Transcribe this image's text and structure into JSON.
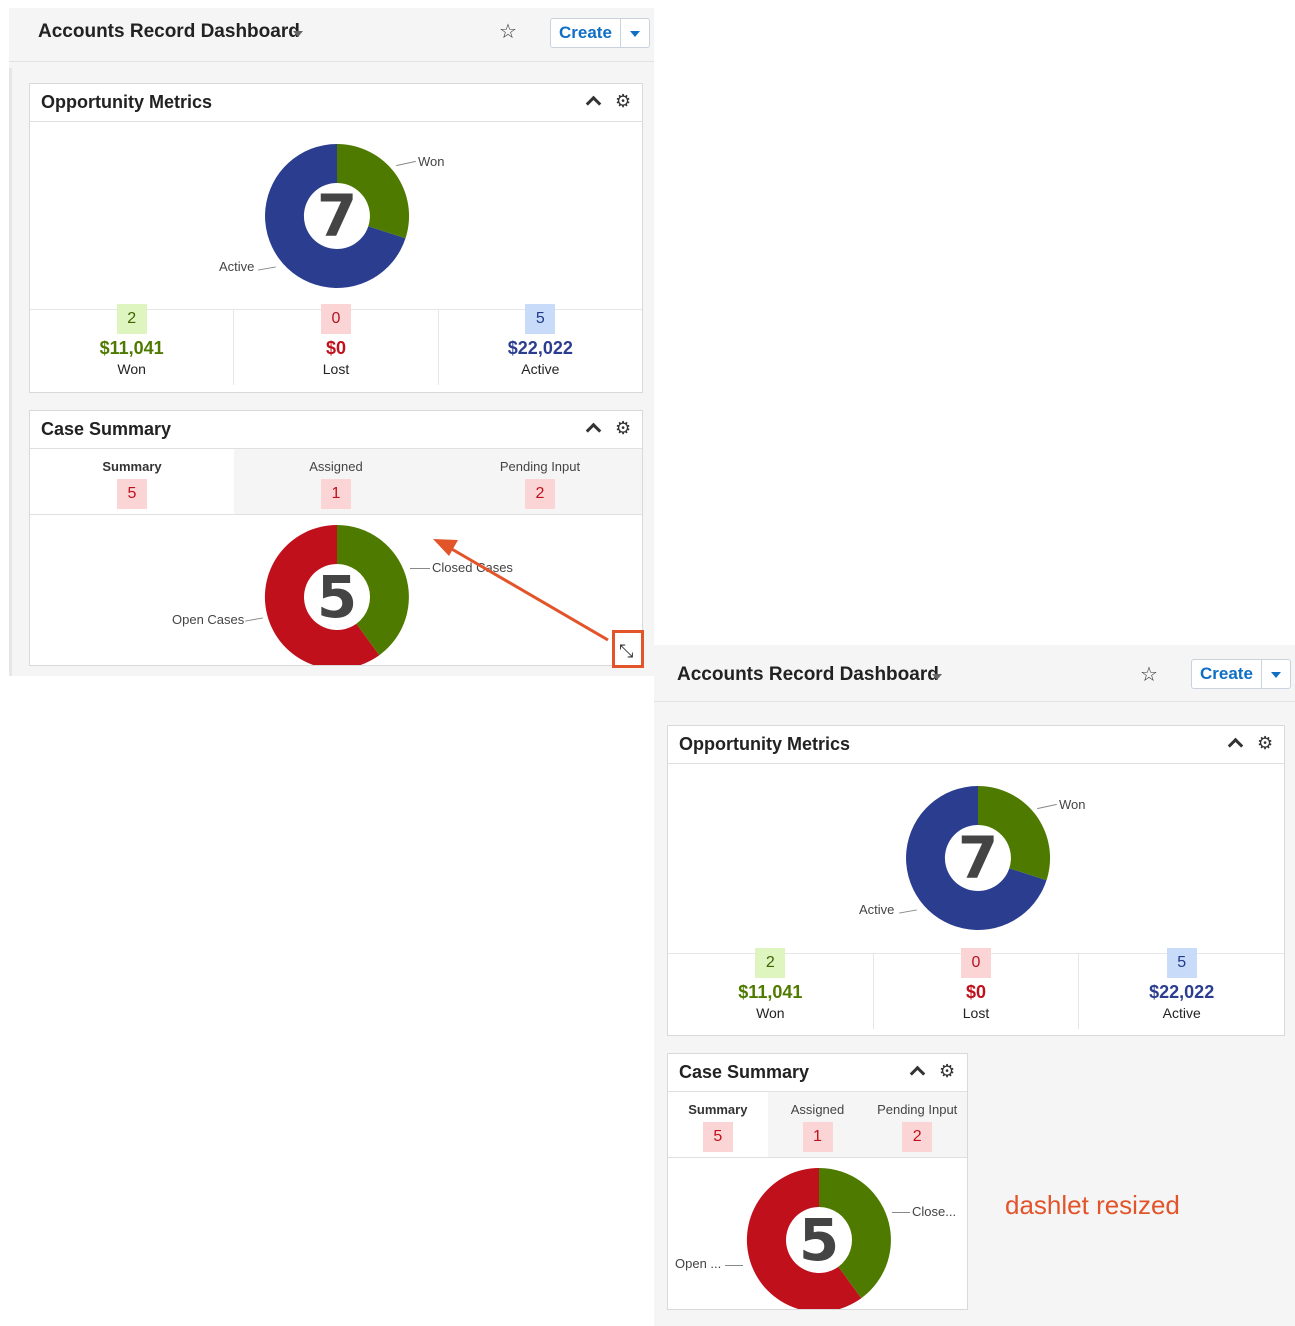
{
  "before": {
    "header": {
      "title": "Accounts Record Dashboard",
      "create_label": "Create"
    },
    "opportunity": {
      "title": "Opportunity Metrics",
      "total": "7",
      "labels": {
        "won": "Won",
        "active": "Active"
      },
      "metrics": [
        {
          "badge": "2",
          "amount": "$11,041",
          "label": "Won"
        },
        {
          "badge": "0",
          "amount": "$0",
          "label": "Lost"
        },
        {
          "badge": "5",
          "amount": "$22,022",
          "label": "Active"
        }
      ],
      "slices": {
        "won": 2,
        "lost": 0,
        "active": 5
      }
    },
    "cases": {
      "title": "Case Summary",
      "tabs": [
        {
          "label": "Summary",
          "count": "5"
        },
        {
          "label": "Assigned",
          "count": "1"
        },
        {
          "label": "Pending Input",
          "count": "2"
        }
      ],
      "total": "5",
      "labels": {
        "closed": "Closed Cases",
        "open": "Open Cases"
      },
      "slices": {
        "closed": 2,
        "open": 3
      }
    }
  },
  "after": {
    "header": {
      "title": "Accounts Record Dashboard",
      "create_label": "Create"
    },
    "opportunity": {
      "title": "Opportunity Metrics",
      "total": "7",
      "labels": {
        "won": "Won",
        "active": "Active"
      },
      "metrics": [
        {
          "badge": "2",
          "amount": "$11,041",
          "label": "Won"
        },
        {
          "badge": "0",
          "amount": "$0",
          "label": "Lost"
        },
        {
          "badge": "5",
          "amount": "$22,022",
          "label": "Active"
        }
      ]
    },
    "cases": {
      "title": "Case Summary",
      "tabs": [
        {
          "label": "Summary",
          "count": "5"
        },
        {
          "label": "Assigned",
          "count": "1"
        },
        {
          "label": "Pending Input",
          "count": "2"
        }
      ],
      "total": "5",
      "labels": {
        "closed": "Close...",
        "open": "Open ..."
      }
    }
  },
  "annotation": {
    "text": "dashlet resized"
  },
  "colors": {
    "won": "#4f7a00",
    "active": "#2b3d8f",
    "closed": "#4f7a00",
    "open": "#c0101c",
    "annotation": "#e2542a"
  },
  "icons": {
    "star": "star-icon",
    "gear": "gear-icon",
    "collapse": "chevron-up-icon",
    "resize": "resize-handle-icon"
  }
}
